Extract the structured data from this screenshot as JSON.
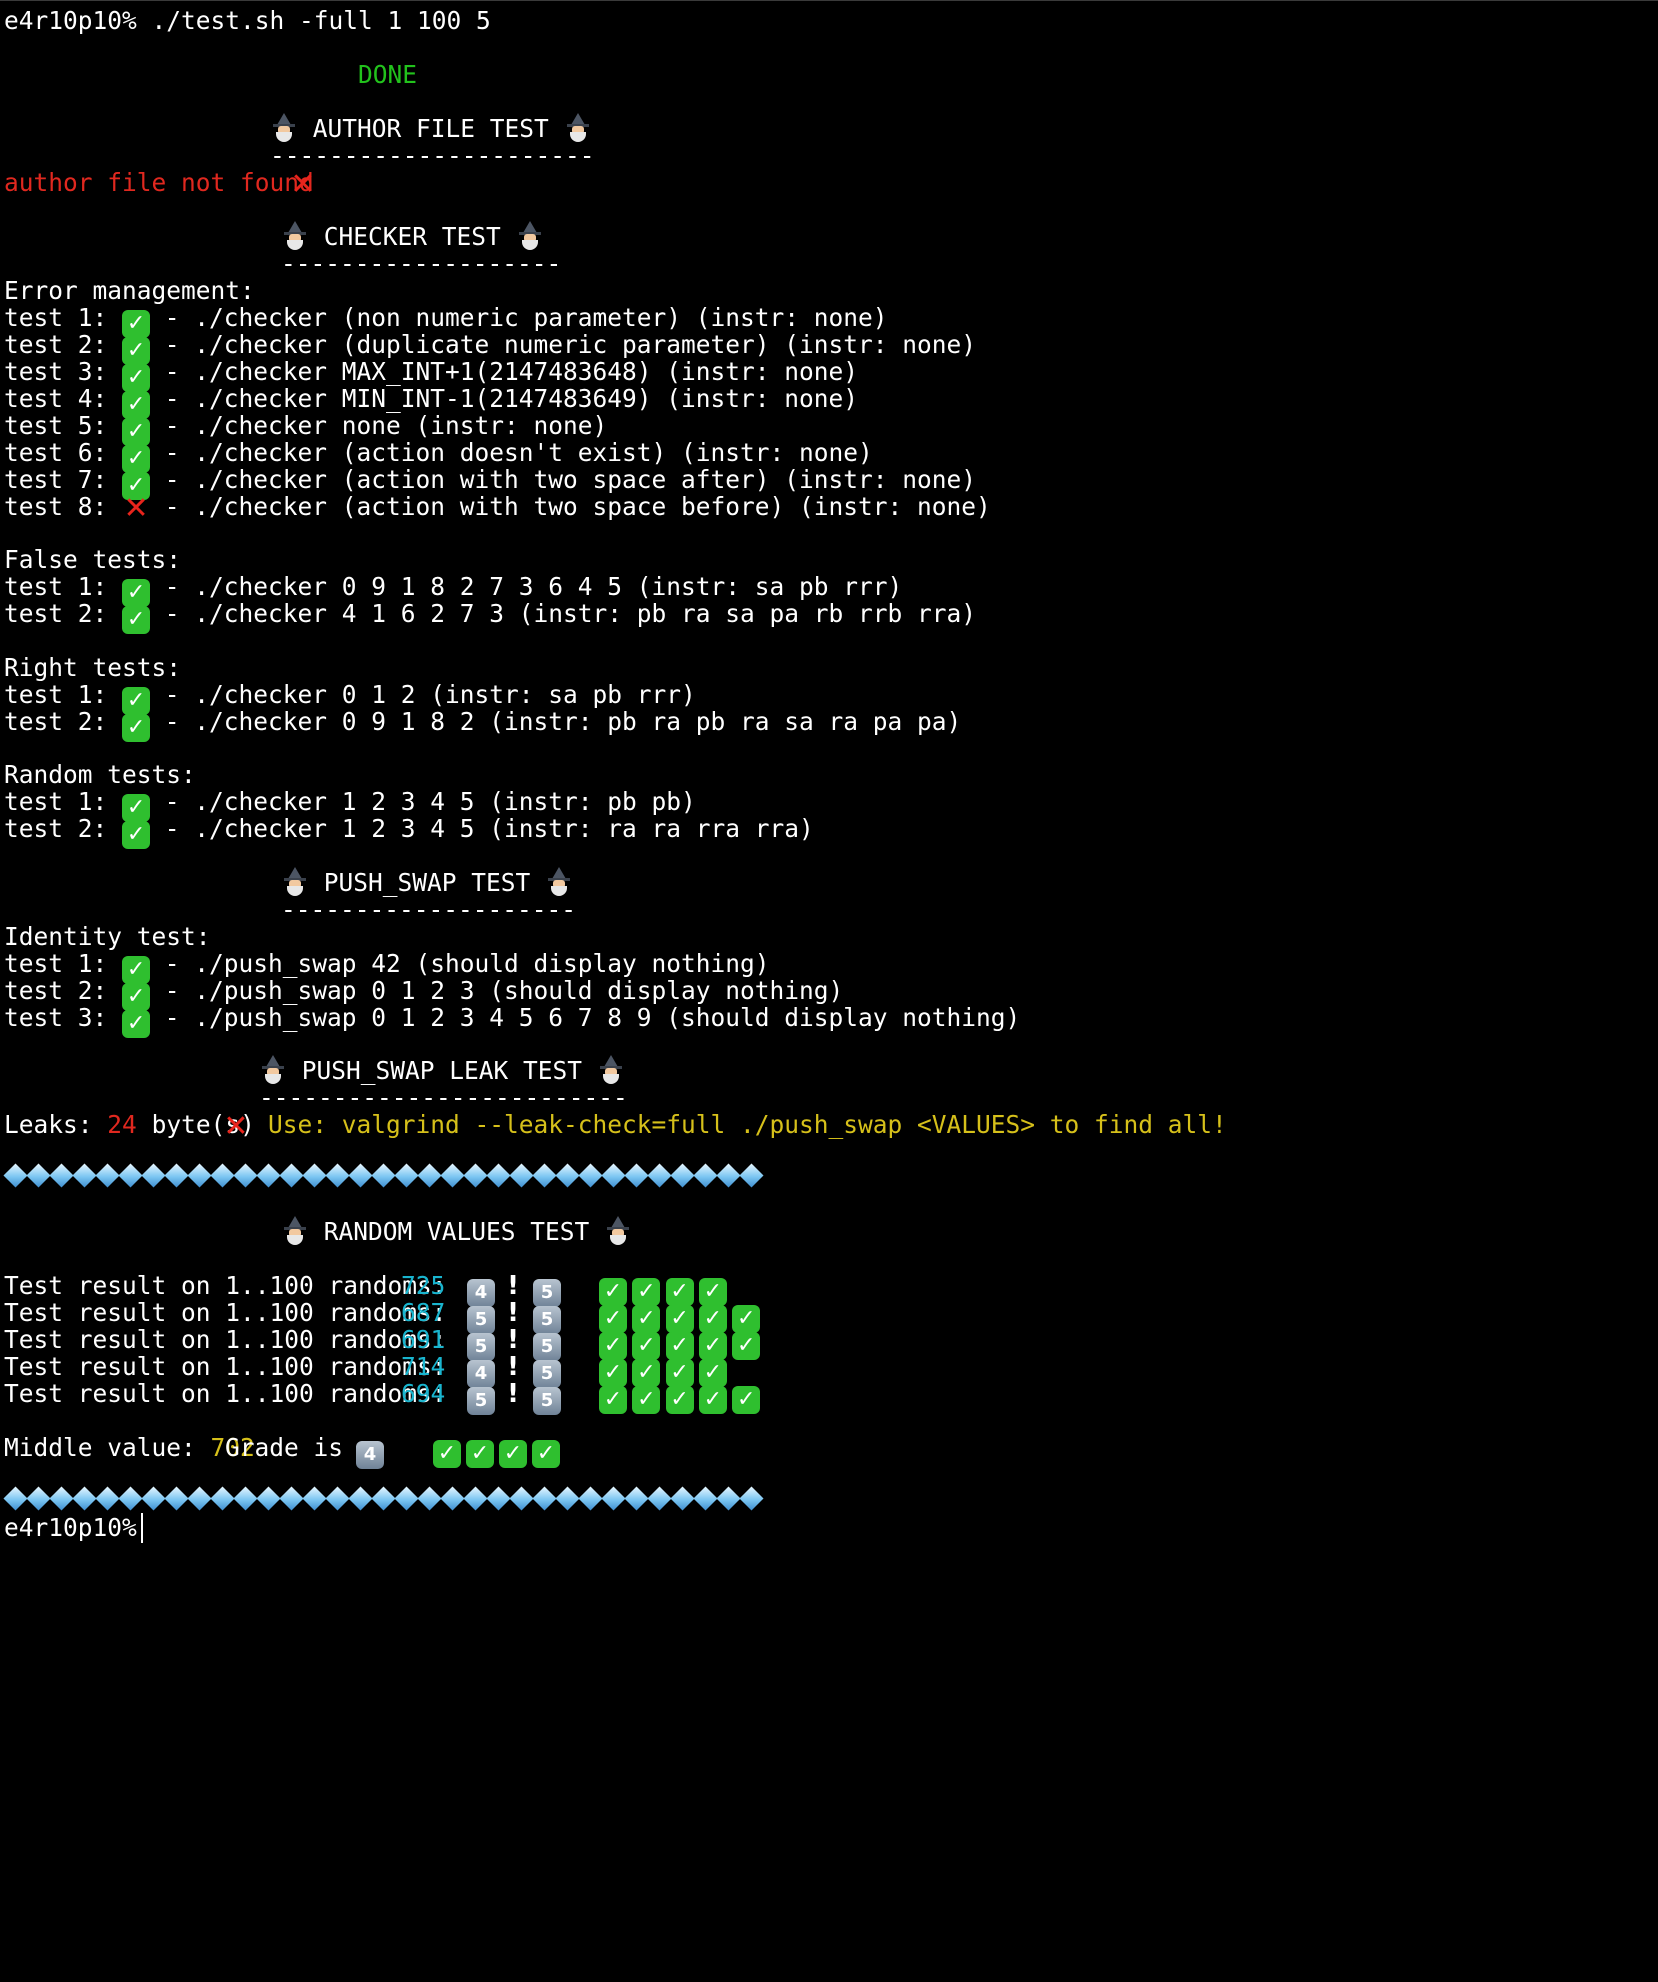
{
  "prompt": {
    "user": "e4r10p10%",
    "command": "./test.sh -full 1 100 5"
  },
  "status": "DONE",
  "author": {
    "title": "AUTHOR FILE TEST",
    "underline": "----------------------",
    "message": "author file not found"
  },
  "checker": {
    "title": "CHECKER TEST",
    "underline": "-------------------",
    "error_heading": "Error management:",
    "error_tests": [
      {
        "label": "test 1:",
        "ok": true,
        "desc": "- ./checker (non numeric parameter) (instr: none)"
      },
      {
        "label": "test 2:",
        "ok": true,
        "desc": "- ./checker (duplicate numeric parameter) (instr: none)"
      },
      {
        "label": "test 3:",
        "ok": true,
        "desc": "- ./checker MAX_INT+1(2147483648) (instr: none)"
      },
      {
        "label": "test 4:",
        "ok": true,
        "desc": "- ./checker MIN_INT-1(2147483649) (instr: none)"
      },
      {
        "label": "test 5:",
        "ok": true,
        "desc": "- ./checker none (instr: none)"
      },
      {
        "label": "test 6:",
        "ok": true,
        "desc": "- ./checker (action doesn't exist) (instr: none)"
      },
      {
        "label": "test 7:",
        "ok": true,
        "desc": "- ./checker (action with two space after) (instr: none)"
      },
      {
        "label": "test 8:",
        "ok": false,
        "desc": "- ./checker (action with two space before) (instr: none)"
      }
    ],
    "false_heading": "False tests:",
    "false_tests": [
      {
        "label": "test 1:",
        "desc": "- ./checker 0 9 1 8 2 7 3 6 4 5 (instr: sa pb rrr)"
      },
      {
        "label": "test 2:",
        "desc": "- ./checker 4 1 6 2 7 3 (instr: pb ra sa pa rb rrb rra)"
      }
    ],
    "right_heading": "Right tests:",
    "right_tests": [
      {
        "label": "test 1:",
        "desc": "- ./checker 0 1 2 (instr: sa pb rrr)"
      },
      {
        "label": "test 2:",
        "desc": "- ./checker 0 9 1 8 2 (instr: pb ra pb ra sa ra pa pa)"
      }
    ],
    "random_heading": "Random tests:",
    "random_tests": [
      {
        "label": "test 1:",
        "desc": "- ./checker 1 2 3 4 5 (instr: pb pb)"
      },
      {
        "label": "test 2:",
        "desc": "- ./checker 1 2 3 4 5 (instr: ra ra rra rra)"
      }
    ]
  },
  "push_swap": {
    "title": "PUSH_SWAP TEST",
    "underline": "--------------------",
    "identity_heading": "Identity test:",
    "identity_tests": [
      {
        "label": "test 1:",
        "desc": "- ./push_swap 42 (should display nothing)"
      },
      {
        "label": "test 2:",
        "desc": "- ./push_swap 0 1 2 3 (should display nothing)"
      },
      {
        "label": "test 3:",
        "desc": "- ./push_swap 0 1 2 3 4 5 6 7 8 9 (should display nothing)"
      }
    ]
  },
  "leak": {
    "title": "PUSH_SWAP LEAK TEST",
    "underline": "-------------------------",
    "label": "Leaks:",
    "bytes": "24",
    "unit": "byte(s)",
    "hint": "Use: valgrind --leak-check=full ./push_swap <VALUES> to find all!"
  },
  "random_values": {
    "title": "RANDOM VALUES TEST",
    "rows": [
      {
        "label": "Test result on 1..100 randoms:",
        "value": "725",
        "grade": "4",
        "max": "5",
        "checks": 4
      },
      {
        "label": "Test result on 1..100 randoms:",
        "value": "687",
        "grade": "5",
        "max": "5",
        "checks": 5
      },
      {
        "label": "Test result on 1..100 randoms:",
        "value": "691",
        "grade": "5",
        "max": "5",
        "checks": 5
      },
      {
        "label": "Test result on 1..100 randoms:",
        "value": "714",
        "grade": "4",
        "max": "5",
        "checks": 4
      },
      {
        "label": "Test result on 1..100 randoms:",
        "value": "694",
        "grade": "5",
        "max": "5",
        "checks": 5
      }
    ],
    "separator": "!",
    "middle_label": "Middle value:",
    "middle_value": "702",
    "grade_label": "Grade is :",
    "grade": "4",
    "grade_checks": 4
  },
  "final_prompt": {
    "user": "e4r10p10%"
  },
  "colors": {
    "background": "#000000",
    "text": "#ffffff",
    "done": "#22c21c",
    "error": "#e0281f",
    "warning": "#d6c01a",
    "number": "#19b5cf"
  },
  "icons": {
    "pass": "check-mark-icon",
    "fail": "cross-mark-icon",
    "title_decoration": "wizard-icon",
    "grade": "keycap-digit-icon",
    "separator_row": "diamond-gem-icon"
  }
}
